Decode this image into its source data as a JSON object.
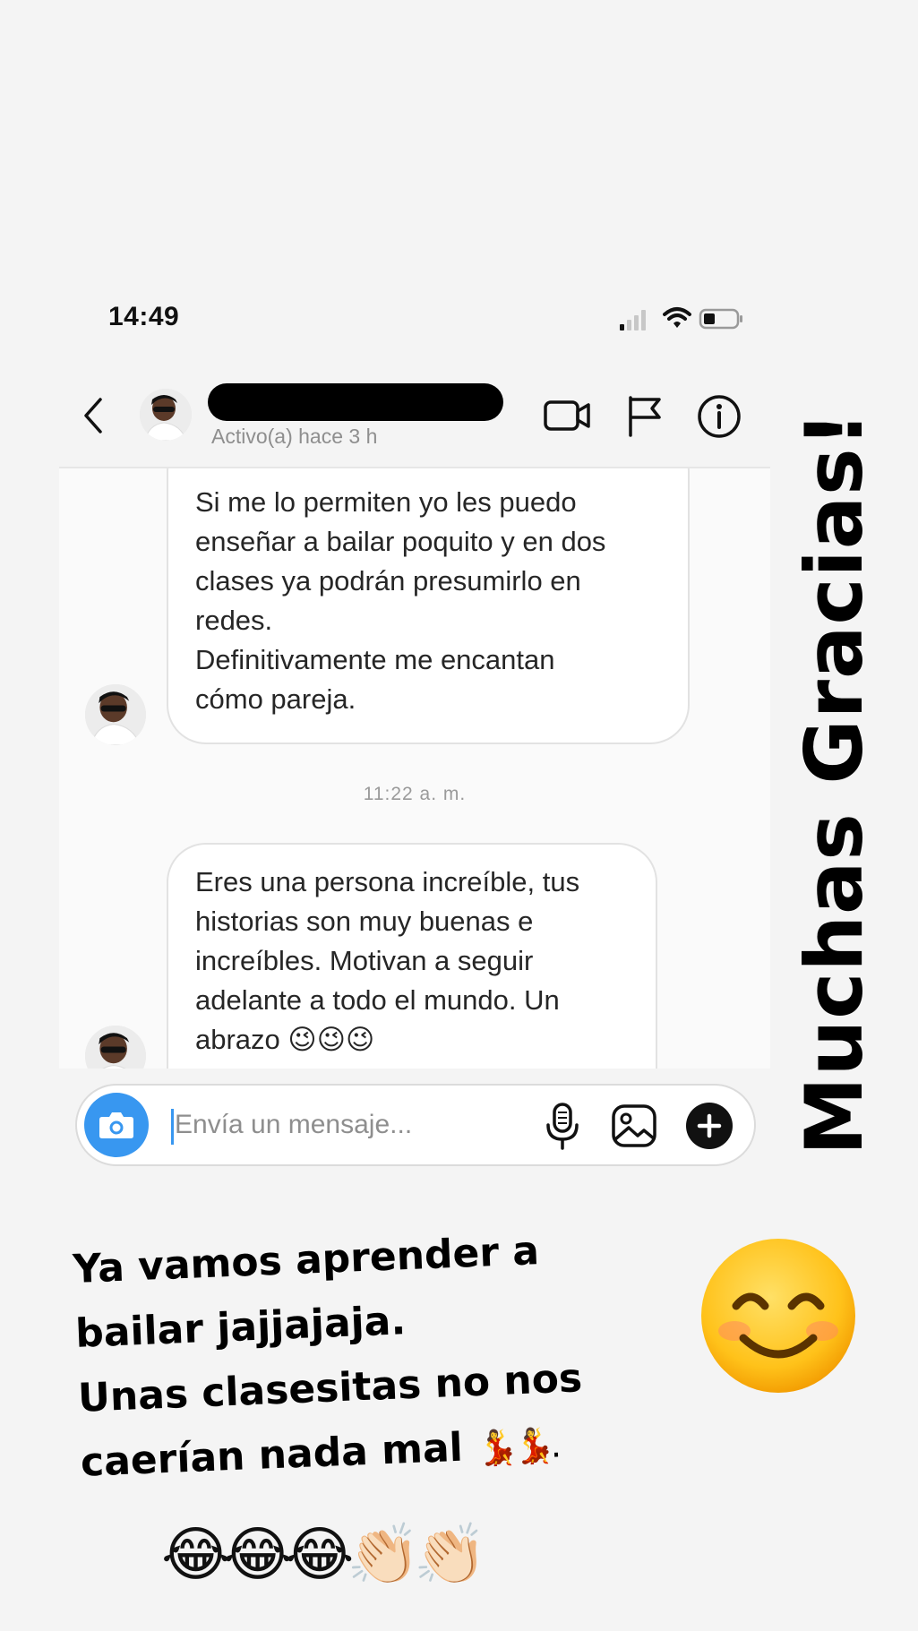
{
  "status_bar": {
    "time": "14:49"
  },
  "header": {
    "active_status": "Activo(a) hace 3 h",
    "icons": [
      "back-chevron-icon",
      "video-call-icon",
      "flag-icon",
      "info-icon"
    ]
  },
  "messages": [
    {
      "text": "Si me lo permiten yo les puedo\nenseñar a bailar poquito y en dos\nclases ya podrán presumirlo en\nredes.\nDefinitivamente me encantan\ncómo pareja."
    },
    {
      "text": "Eres una persona increíble, tus\nhistorias son muy buenas e\nincreíbles. Motivan a seguir\nadelante a todo el mundo. Un\nabrazo 😉😉😉"
    }
  ],
  "timestamp": "11:22 a. m.",
  "composer": {
    "placeholder": "Envía un mensaje...",
    "icons": [
      "camera-icon",
      "microphone-icon",
      "gallery-icon",
      "plus-icon"
    ]
  },
  "overlay": {
    "vertical_text": "Muchas Gracias!",
    "caption_lines": [
      "Ya vamos aprender a",
      "bailar jajjajaja.",
      "Unas clasesitas no nos",
      "caerían nada mal"
    ],
    "caption_tail": "💃💃.",
    "emoji_row": "😂😂😂👏🏻👏🏻"
  },
  "colors": {
    "accent_blue": "#3897f0",
    "background": "#f4f4f4",
    "bubble_border": "#e2e2e2",
    "muted_text": "#8e8e8e"
  }
}
